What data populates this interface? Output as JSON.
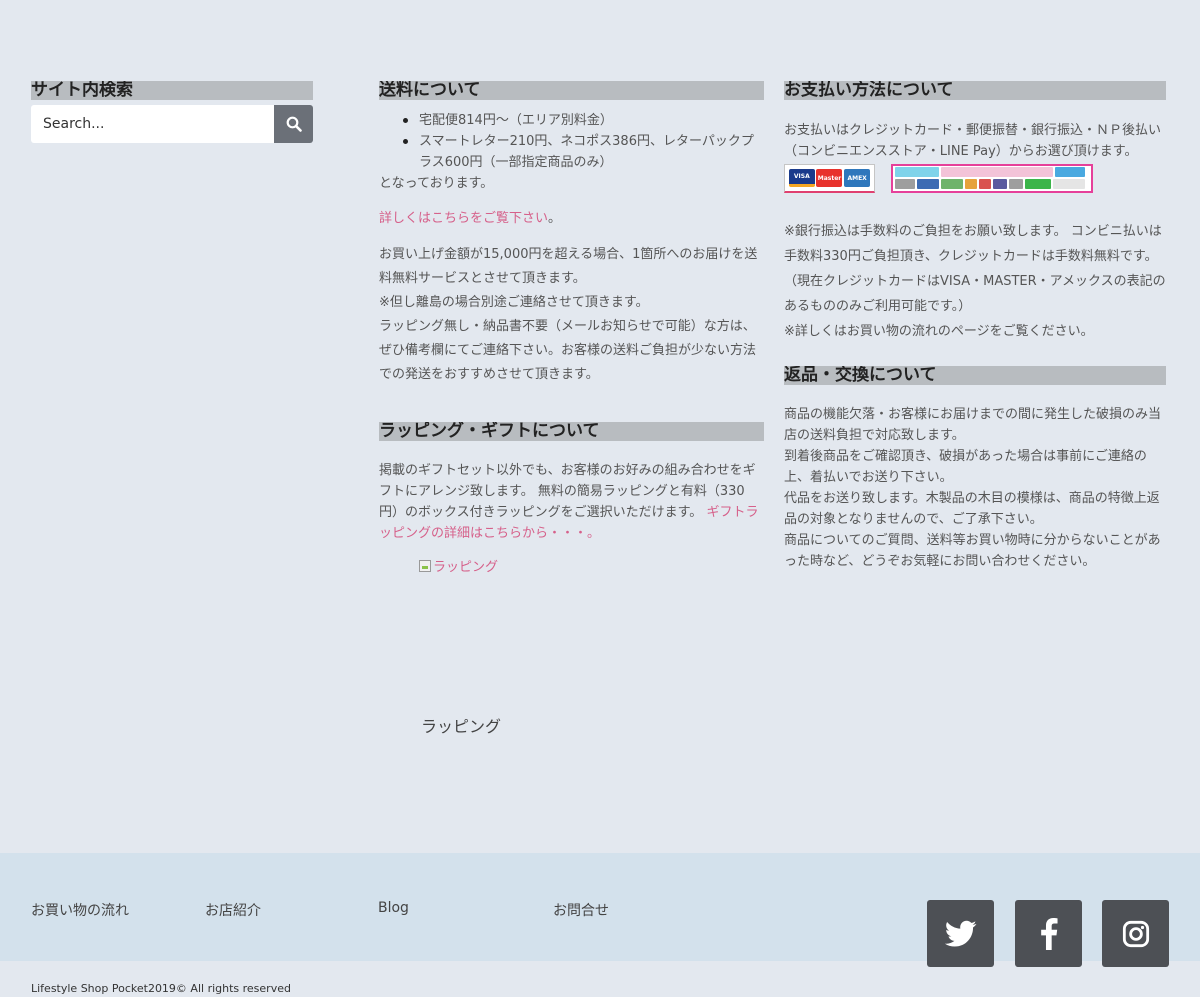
{
  "search": {
    "heading": "サイト内検索",
    "placeholder": "Search..."
  },
  "shipping": {
    "heading": "送料について",
    "bullets": [
      "宅配便814円～（エリア別料金）",
      "スマートレター210円、ネコポス386円、レターパックプラス600円（一部指定商品のみ）"
    ],
    "after_list": "となっております。",
    "detail_link": "詳しくはこちらをご覧下さい",
    "detail_suffix": "。",
    "paragraphs": [
      "お買い上げ金額が15,000円を超える場合、1箇所へのお届けを送料無料サービスとさせて頂きます。",
      "※但し離島の場合別途ご連絡させて頂きます。",
      "ラッピング無し・納品書不要（メールお知らせで可能）な方は、ぜひ備考欄にてご連絡下さい。お客様の送料ご負担が少ない方法での発送をおすすめさせて頂きます。"
    ]
  },
  "gift": {
    "heading": "ラッピング・ギフトについて",
    "text": "掲載のギフトセット以外でも、お客様のお好みの組み合わせをギフトにアレンジ致します。 無料の簡易ラッピングと有料（330円）のボックス付きラッピングをご選択いただけます。",
    "link": "ギフトラッピングの詳細はこちらから・・・。",
    "image_alt": "ラッピング",
    "caption": "ラッピング"
  },
  "payment": {
    "heading": "お支払い方法について",
    "intro": "お支払いはクレジットカード・郵便振替・銀行振込・ＮＰ後払い（コンビニエンスストア・LINE Pay）からお選び頂けます。",
    "card_labels": [
      "VISA",
      "Master",
      "AMEX"
    ],
    "paragraphs": [
      "※銀行振込は手数料のご負担をお願い致します。 コンビニ払いは手数料330円ご負担頂き、クレジットカードは手数料無料です。 （現在クレジットカードはVISA・MASTER・アメックスの表記のあるもののみご利用可能です。）",
      "※詳しくはお買い物の流れのページをご覧ください。"
    ]
  },
  "returns": {
    "heading": "返品・交換について",
    "paragraphs": [
      "商品の機能欠落・お客様にお届けまでの間に発生した破損のみ当店の送料負担で対応致します。",
      "到着後商品をご確認頂き、破損があった場合は事前にご連絡の上、着払いでお送り下さい。",
      "代品をお送り致します。木製品の木目の模様は、商品の特徴上返品の対象となりませんので、ご了承下さい。",
      "商品についてのご質問、送料等お買い物時に分からないことがあった時など、どうぞお気軽にお問い合わせください。"
    ]
  },
  "footer": {
    "links": [
      "お買い物の流れ",
      "お店紹介",
      "Blog",
      "お問合せ"
    ],
    "social_icons": [
      "twitter-icon",
      "facebook-icon",
      "instagram-icon"
    ],
    "copyright": "Lifestyle Shop Pocket2019© All rights reserved"
  },
  "colors": {
    "background": "#e3e8ef",
    "footer_bg": "#d3e1ec",
    "heading_bg": "#b8bcc0",
    "link": "#d6608a",
    "social_bg": "#4d5055"
  }
}
